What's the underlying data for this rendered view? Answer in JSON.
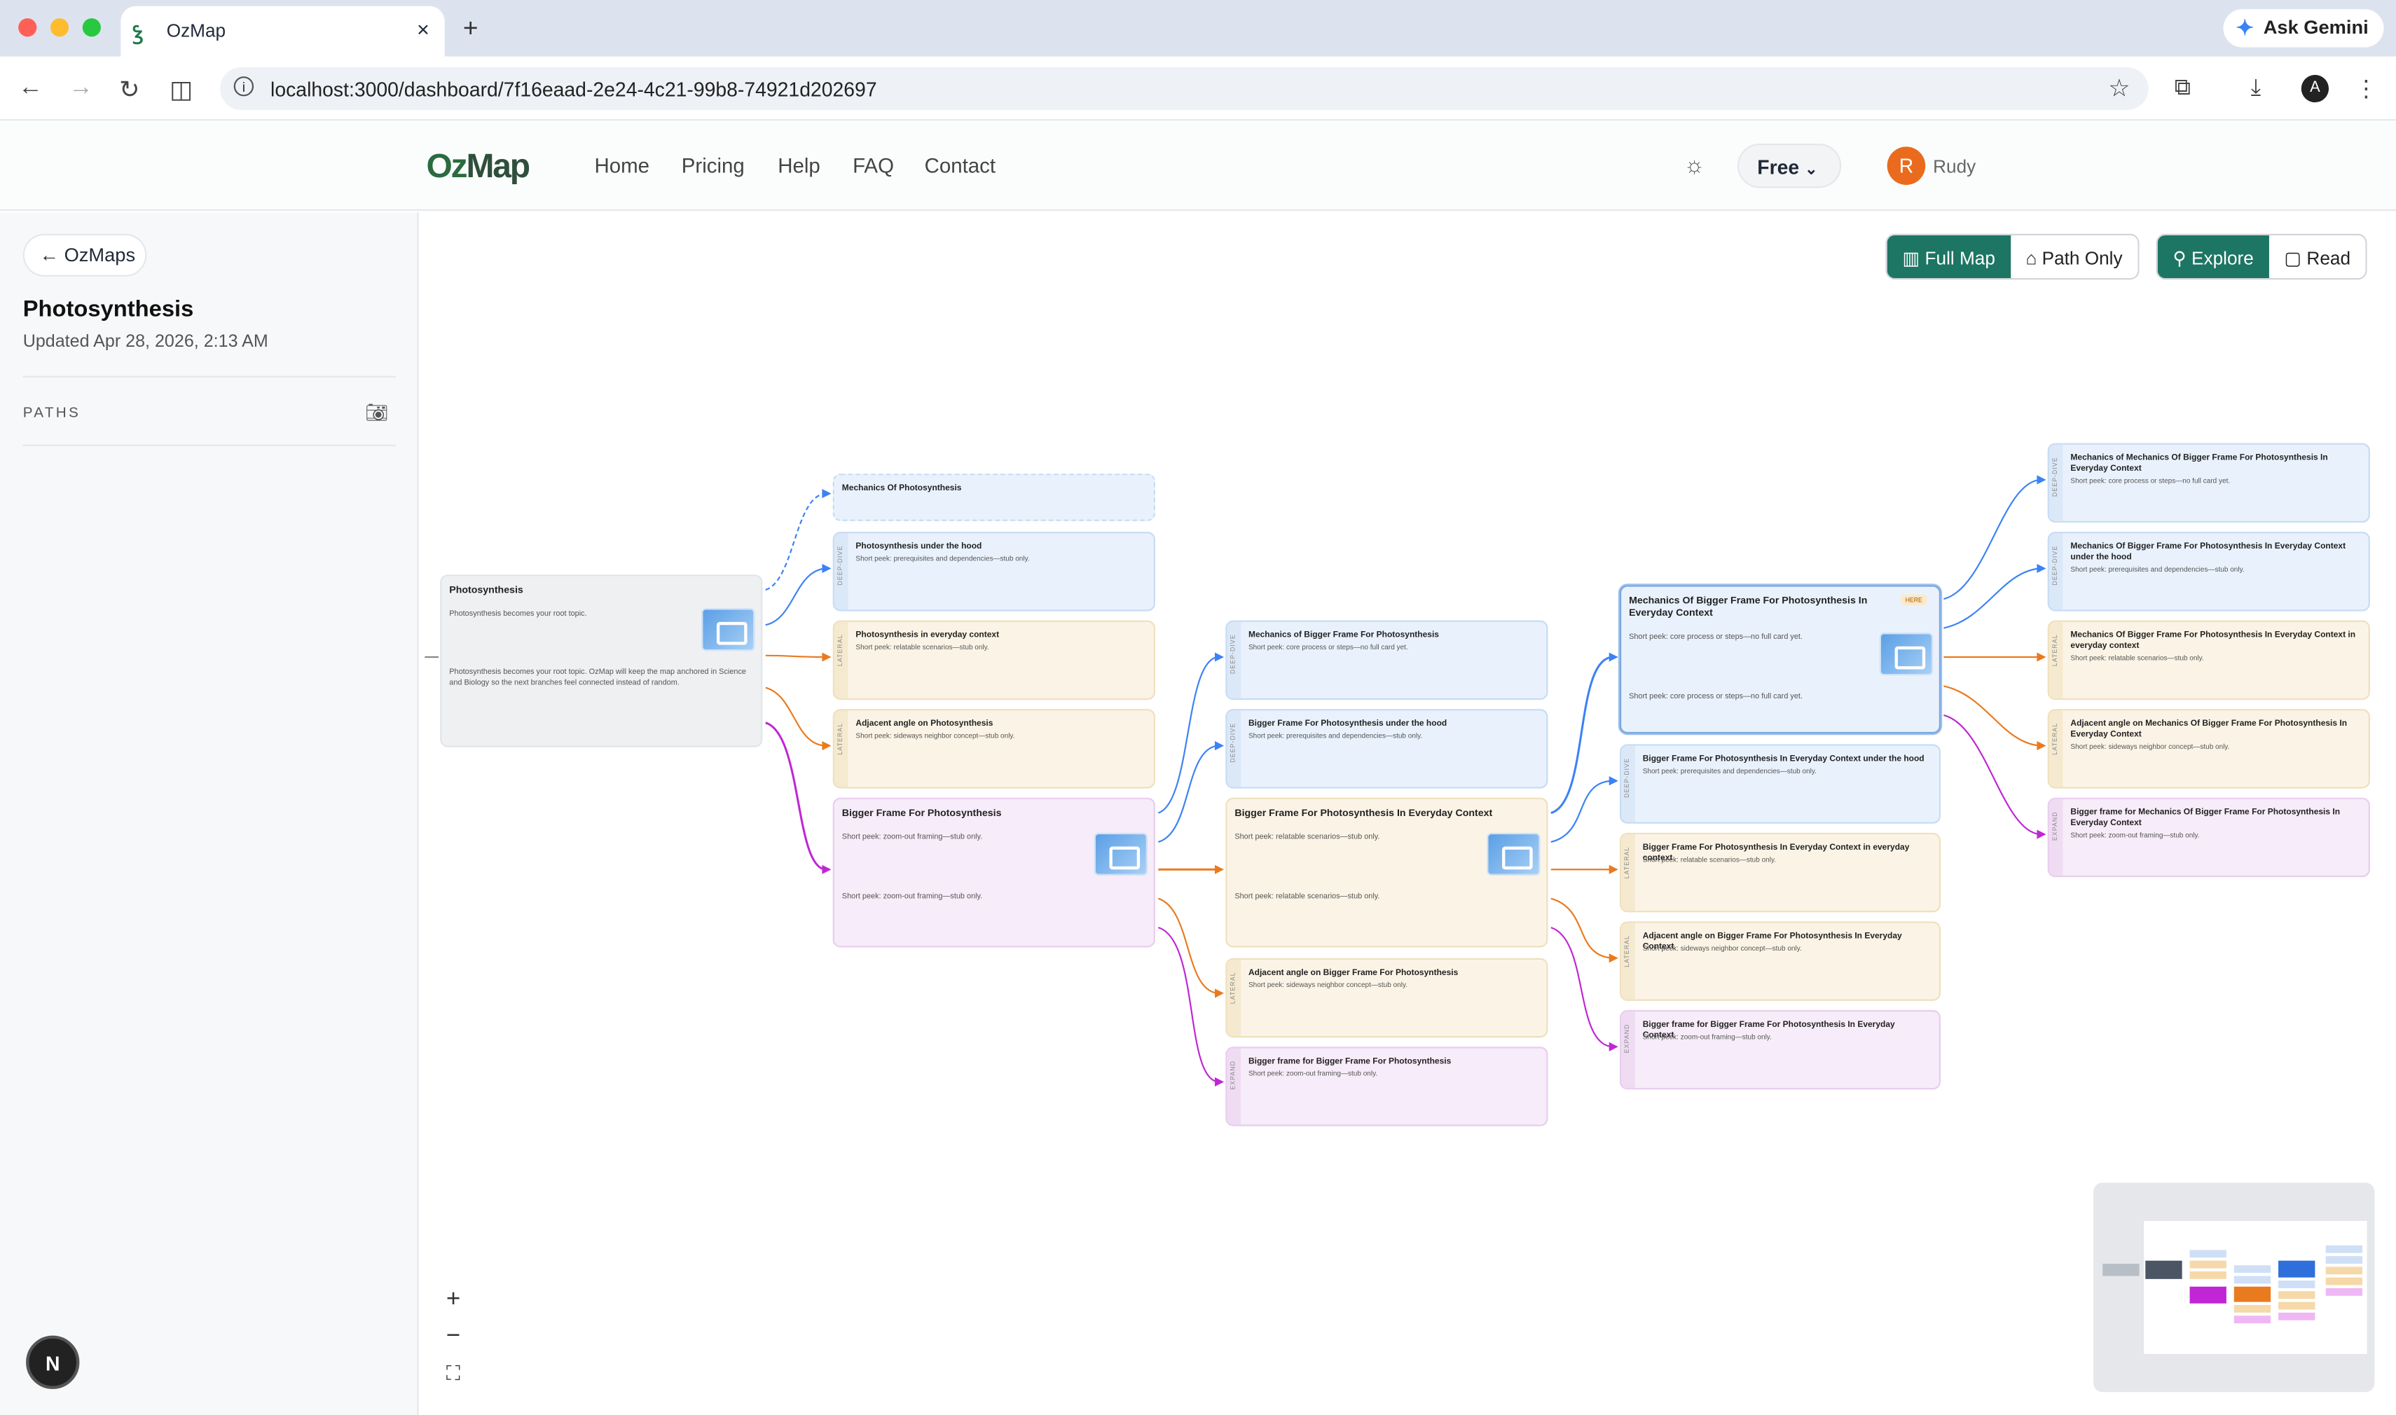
{
  "browser": {
    "tab_title": "OzMap",
    "ask_gemini": "Ask Gemini",
    "url": "localhost:3000/dashboard/7f16eaad-2e24-4c21-99b8-74921d202697",
    "profile_initial": "A"
  },
  "app": {
    "logo": "OzMap",
    "logo_oz": "Oz",
    "logo_map": "Map",
    "nav": [
      "Home",
      "Pricing",
      "Help",
      "FAQ",
      "Contact"
    ],
    "plan": "Free",
    "user_initial": "R",
    "user_name": "Rudy"
  },
  "sidebar": {
    "back": "OzMaps",
    "title": "Photosynthesis",
    "updated": "Updated Apr 28, 2026, 2:13 AM",
    "paths_label": "PATHS",
    "next_initial": "N"
  },
  "toolbar": {
    "view": [
      "Full Map",
      "Path Only"
    ],
    "mode": [
      "Explore",
      "Read"
    ],
    "active_view": "Full Map",
    "active_mode": "Explore"
  },
  "nodes": [
    {
      "title": "Photosynthesis",
      "peek": "Photosynthesis becomes your root topic.",
      "body": "Photosynthesis becomes your root topic. OzMap will keep the map anchored in Science and Biology so the next branches feel connected instead of random."
    },
    {
      "title": "Mechanics Of Photosynthesis"
    },
    {
      "tag": "DEEP-DIVE",
      "title": "Photosynthesis under the hood",
      "peek": "Short peek: prerequisites and dependencies—stub only."
    },
    {
      "tag": "LATERAL",
      "title": "Photosynthesis in everyday context",
      "peek": "Short peek: relatable scenarios—stub only."
    },
    {
      "tag": "LATERAL",
      "title": "Adjacent angle on Photosynthesis",
      "peek": "Short peek: sideways neighbor concept—stub only."
    },
    {
      "title": "Bigger Frame For Photosynthesis",
      "peek": "Short peek: zoom-out framing—stub only.",
      "body": "Short peek: zoom-out framing—stub only."
    },
    {
      "tag": "DEEP-DIVE",
      "title": "Mechanics of Bigger Frame For Photosynthesis",
      "peek": "Short peek: core process or steps—no full card yet."
    },
    {
      "tag": "DEEP-DIVE",
      "title": "Bigger Frame For Photosynthesis under the hood",
      "peek": "Short peek: prerequisites and dependencies—stub only."
    },
    {
      "title": "Bigger Frame For Photosynthesis In Everyday Context",
      "peek": "Short peek: relatable scenarios—stub only.",
      "body": "Short peek: relatable scenarios—stub only."
    },
    {
      "tag": "LATERAL",
      "title": "Adjacent angle on Bigger Frame For Photosynthesis",
      "peek": "Short peek: sideways neighbor concept—stub only."
    },
    {
      "tag": "EXPAND",
      "title": "Bigger frame for Bigger Frame For Photosynthesis",
      "peek": "Short peek: zoom-out framing—stub only."
    },
    {
      "title": "Mechanics Of Bigger Frame For Photosynthesis In Everyday Context",
      "badge": "HERE",
      "peek": "Short peek: core process or steps—no full card yet.",
      "body": "Short peek: core process or steps—no full card yet."
    },
    {
      "tag": "DEEP-DIVE",
      "title": "Bigger Frame For Photosynthesis In Everyday Context under the hood",
      "peek": "Short peek: prerequisites and dependencies—stub only."
    },
    {
      "tag": "LATERAL",
      "title": "Bigger Frame For Photosynthesis In Everyday Context in everyday context",
      "peek": "Short peek: relatable scenarios—stub only."
    },
    {
      "tag": "LATERAL",
      "title": "Adjacent angle on Bigger Frame For Photosynthesis In Everyday Context",
      "peek": "Short peek: sideways neighbor concept—stub only."
    },
    {
      "tag": "EXPAND",
      "title": "Bigger frame for Bigger Frame For Photosynthesis In Everyday Context",
      "peek": "Short peek: zoom-out framing—stub only."
    },
    {
      "tag": "DEEP-DIVE",
      "title": "Mechanics of Mechanics Of Bigger Frame For Photosynthesis In Everyday Context",
      "peek": "Short peek: core process or steps—no full card yet."
    },
    {
      "tag": "DEEP-DIVE",
      "title": "Mechanics Of Bigger Frame For Photosynthesis In Everyday Context under the hood",
      "peek": "Short peek: prerequisites and dependencies—stub only."
    },
    {
      "tag": "LATERAL",
      "title": "Mechanics Of Bigger Frame For Photosynthesis In Everyday Context in everyday context",
      "peek": "Short peek: relatable scenarios—stub only."
    },
    {
      "tag": "LATERAL",
      "title": "Adjacent angle on Mechanics Of Bigger Frame For Photosynthesis In Everyday Context",
      "peek": "Short peek: sideways neighbor concept—stub only."
    },
    {
      "tag": "EXPAND",
      "title": "Bigger frame for Mechanics Of Bigger Frame For Photosynthesis In Everyday Context",
      "peek": "Short peek: zoom-out framing—stub only."
    }
  ],
  "colors": {
    "deep": "#3b82f6",
    "lateral": "#ea7a1e",
    "expand": "#c026d3",
    "accent": "#1d7563"
  }
}
